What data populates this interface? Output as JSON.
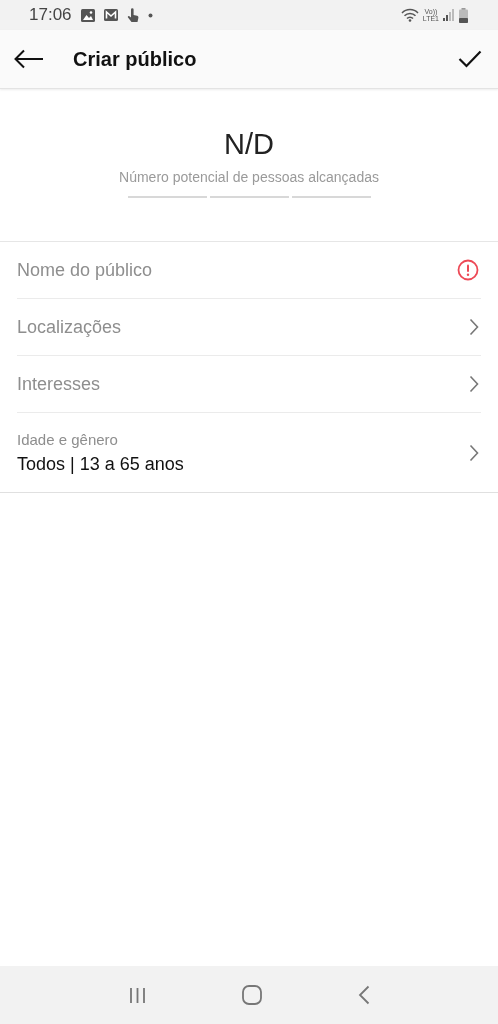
{
  "status_bar": {
    "time": "17:06",
    "network_top": "Vo))",
    "network_bottom": "LTE1"
  },
  "header": {
    "title": "Criar público"
  },
  "reach": {
    "value": "N/D",
    "caption": "Número potencial de pessoas alcançadas"
  },
  "rows": [
    {
      "kind": "field",
      "label": "Nome do público",
      "error": true
    },
    {
      "kind": "nav",
      "label": "Localizações"
    },
    {
      "kind": "nav",
      "label": "Interesses"
    },
    {
      "kind": "value",
      "label": "Idade e gênero",
      "value": "Todos | 13 a 65 anos"
    }
  ]
}
